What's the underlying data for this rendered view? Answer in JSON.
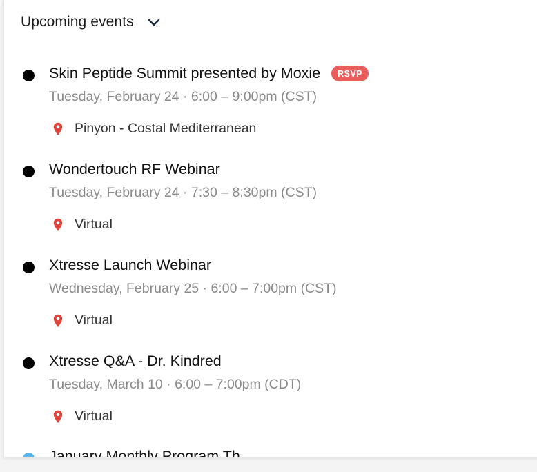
{
  "header": {
    "title": "Upcoming events",
    "toggle_icon": "chevron-down-icon"
  },
  "colors": {
    "bullet": "#000000",
    "rsvp_badge": "#ea5d5d",
    "pin": "#e0443c",
    "next_bullet": "#5ab4e5"
  },
  "events": [
    {
      "title": "Skin Peptide Summit presented by Moxie",
      "badge": "RSVP",
      "date": "Tuesday, February 24 · 6:00 – 9:00pm (CST)",
      "location": "Pinyon - Costal Mediterranean",
      "location_icon": "map-pin-icon"
    },
    {
      "title": "Wondertouch RF Webinar",
      "date": "Tuesday, February 24 · 7:30 – 8:30pm (CST)",
      "location": "Virtual",
      "location_icon": "map-pin-icon"
    },
    {
      "title": "Xtresse Launch Webinar",
      "date": "Wednesday, February 25 · 6:00 – 7:00pm (CST)",
      "location": "Virtual",
      "location_icon": "map-pin-icon"
    },
    {
      "title": "Xtresse Q&A - Dr. Kindred",
      "date": "Tuesday, March 10 · 6:00 – 7:00pm (CDT)",
      "location": "Virtual",
      "location_icon": "map-pin-icon"
    }
  ],
  "partial_event": {
    "title": "January Monthly Program Th..."
  }
}
